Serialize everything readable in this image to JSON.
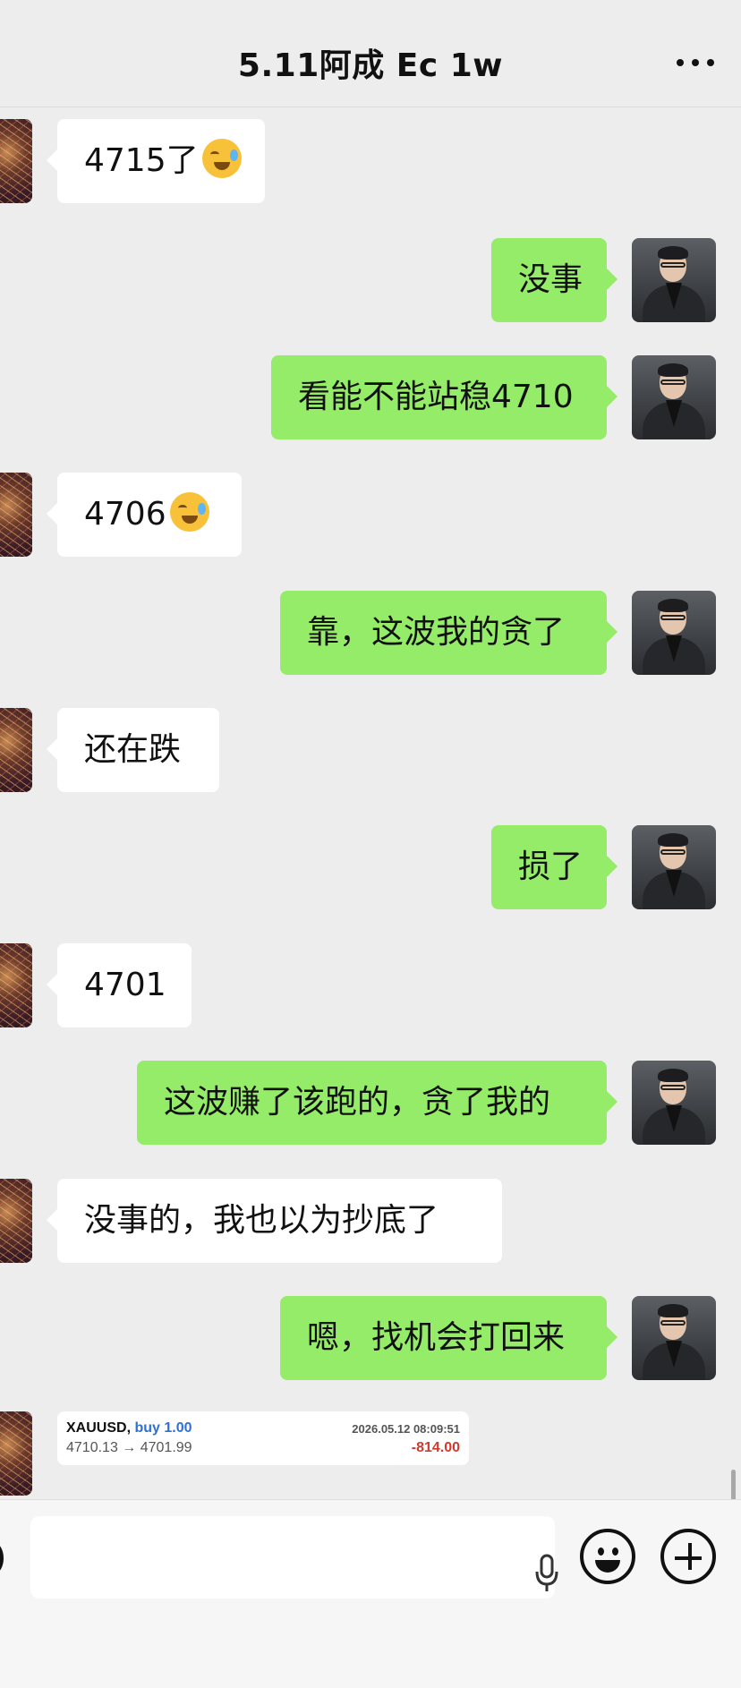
{
  "header": {
    "title": "5.11阿成 Ec 1w",
    "more_icon": "more-dots-icon"
  },
  "messages": [
    {
      "side": "in",
      "text": "4715了",
      "emoji": "laughing-crying-emoji"
    },
    {
      "side": "out",
      "text": "没事"
    },
    {
      "side": "out",
      "text": "看能不能站稳4710"
    },
    {
      "side": "in",
      "text": "4706",
      "emoji": "laughing-crying-emoji"
    },
    {
      "side": "out",
      "text": "靠，这波我的贪了"
    },
    {
      "side": "in",
      "text": "还在跌"
    },
    {
      "side": "out",
      "text": "损了"
    },
    {
      "side": "in",
      "text": "4701"
    },
    {
      "side": "out",
      "text": "这波赚了该跑的，贪了我的"
    },
    {
      "side": "in",
      "text": "没事的，我也以为抄底了"
    },
    {
      "side": "out",
      "text": "嗯，找机会打回来"
    }
  ],
  "trade_card": {
    "symbol": "XAUUSD,",
    "direction": "buy 1.00",
    "timestamp": "2026.05.12 08:09:51",
    "prices": "4710.13 → 4701.99",
    "pnl": "-814.00",
    "pnl_color": "#d23a2e",
    "direction_color": "#2f6fd6"
  },
  "input_bar": {
    "voice_icon": "voice-toggle-icon",
    "mic_icon": "microphone-icon",
    "emoji_icon": "emoji-icon",
    "plus_icon": "plus-icon"
  },
  "colors": {
    "background": "#ededed",
    "outgoing_bubble": "#95ec69",
    "incoming_bubble": "#ffffff"
  }
}
